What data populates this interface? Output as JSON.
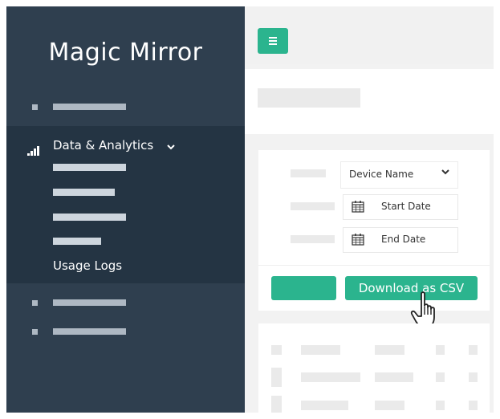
{
  "app": {
    "title": "Magic Mirror"
  },
  "sidebar": {
    "active_section": {
      "label": "Data & Analytics",
      "icon": "signal-bars-icon",
      "expanded_icon": "chevron-down-icon"
    },
    "active_item": {
      "label": "Usage Logs"
    }
  },
  "header": {
    "menu_icon": "hamburger-menu-icon"
  },
  "filters": {
    "device_select": {
      "value": "Device Name",
      "icon": "chevron-down-icon"
    },
    "start_date": {
      "placeholder": "Start Date",
      "icon": "calendar-icon"
    },
    "end_date": {
      "placeholder": "End Date",
      "icon": "calendar-icon"
    }
  },
  "actions": {
    "download_label": "Download as CSV"
  },
  "colors": {
    "sidebar_bg": "#2f3f4f",
    "sidebar_active_bg": "#243443",
    "accent": "#2bb48e",
    "main_bg": "#f2f2f2"
  }
}
